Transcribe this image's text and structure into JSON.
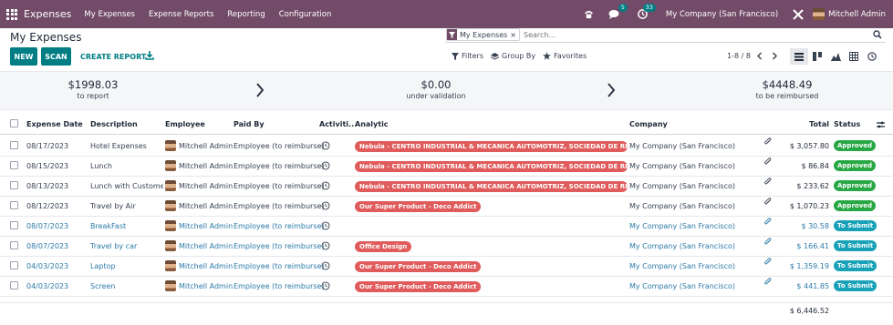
{
  "navbar": {
    "app_name": "Expenses",
    "menu": [
      "My Expenses",
      "Expense Reports",
      "Reporting",
      "Configuration"
    ],
    "chat_badge": "5",
    "activity_badge": "33",
    "company": "My Company (San Francisco)",
    "user": "Mitchell Admin"
  },
  "page": {
    "title": "My Expenses",
    "new_label": "NEW",
    "scan_label": "SCAN",
    "create_report_label": "CREATE REPORT"
  },
  "search": {
    "facet_label": "My Expenses",
    "facet_remove": "×",
    "placeholder": "Search..."
  },
  "filters": {
    "filters_label": "Filters",
    "group_by_label": "Group By",
    "favorites_label": "Favorites"
  },
  "pager": {
    "value": "1-8 / 8"
  },
  "summary": {
    "to_report_amount": "$1998.03",
    "to_report_label": "to report",
    "validation_amount": "$0.00",
    "validation_label": "under validation",
    "reimbursed_amount": "$4448.49",
    "reimbursed_label": "to be reimbursed"
  },
  "table": {
    "headers": {
      "date": "Expense Date",
      "description": "Description",
      "employee": "Employee",
      "paid_by": "Paid By",
      "activities": "Activiti...",
      "analytic": "Analytic",
      "company": "Company",
      "total": "Total",
      "status": "Status"
    },
    "rows": [
      {
        "date": "08/17/2023",
        "description": "Hotel Expenses",
        "employee": "Mitchell Admin",
        "paid_by": "Employee (to reimburse)",
        "analytic": "Nebula - CENTRO INDUSTRIAL & MECANICA AUTOMOTRIZ, SOCIEDAD DE RESPONSABILIDAD",
        "company": "My Company (San Francisco)",
        "total": "$ 3,057.80",
        "status": "Approved"
      },
      {
        "date": "08/15/2023",
        "description": "Lunch",
        "employee": "Mitchell Admin",
        "paid_by": "Employee (to reimburse)",
        "analytic": "Nebula - CENTRO INDUSTRIAL & MECANICA AUTOMOTRIZ, SOCIEDAD DE RESPONSABILIDAD",
        "company": "My Company (San Francisco)",
        "total": "$ 86.84",
        "status": "Approved"
      },
      {
        "date": "08/13/2023",
        "description": "Lunch with Customer",
        "employee": "Mitchell Admin",
        "paid_by": "Employee (to reimburse)",
        "analytic": "Nebula - CENTRO INDUSTRIAL & MECANICA AUTOMOTRIZ, SOCIEDAD DE RESPONSABILIDAD",
        "company": "My Company (San Francisco)",
        "total": "$ 233.62",
        "status": "Approved"
      },
      {
        "date": "08/12/2023",
        "description": "Travel by Air",
        "employee": "Mitchell Admin",
        "paid_by": "Employee (to reimburse)",
        "analytic": "Our Super Product - Deco Addict",
        "company": "My Company (San Francisco)",
        "total": "$ 1,070.23",
        "status": "Approved"
      },
      {
        "date": "08/07/2023",
        "description": "BreakFast",
        "employee": "Mitchell Admin",
        "paid_by": "Employee (to reimburse)",
        "analytic": "",
        "company": "My Company (San Francisco)",
        "total": "$ 30.58",
        "status": "To Submit"
      },
      {
        "date": "08/07/2023",
        "description": "Travel by car",
        "employee": "Mitchell Admin",
        "paid_by": "Employee (to reimburse)",
        "analytic": "Office Design",
        "company": "My Company (San Francisco)",
        "total": "$ 166.41",
        "status": "To Submit"
      },
      {
        "date": "04/03/2023",
        "description": "Laptop",
        "employee": "Mitchell Admin",
        "paid_by": "Employee (to reimburse)",
        "analytic": "Our Super Product - Deco Addict",
        "company": "My Company (San Francisco)",
        "total": "$ 1,359.19",
        "status": "To Submit"
      },
      {
        "date": "04/03/2023",
        "description": "Screen",
        "employee": "Mitchell Admin",
        "paid_by": "Employee (to reimburse)",
        "analytic": "Our Super Product - Deco Addict",
        "company": "My Company (San Francisco)",
        "total": "$ 441.85",
        "status": "To Submit"
      }
    ],
    "grand_total": "$ 6,446.52"
  },
  "colors": {
    "brand": "#714b67",
    "primary_button": "#017e84",
    "analytic_tag": "#e05b5b",
    "approved": "#28a745",
    "to_submit": "#17a2b8"
  },
  "icons": [
    "apps-grid-icon",
    "phone-icon",
    "chat-icon",
    "clock-icon",
    "tools-icon",
    "download-icon",
    "filter-icon",
    "layers-icon",
    "star-icon",
    "search-icon",
    "list-view-icon",
    "kanban-view-icon",
    "graph-view-icon",
    "pivot-view-icon",
    "activity-view-icon",
    "chevron-left-icon",
    "chevron-right-icon",
    "paperclip-icon",
    "settings-toggle-icon"
  ]
}
